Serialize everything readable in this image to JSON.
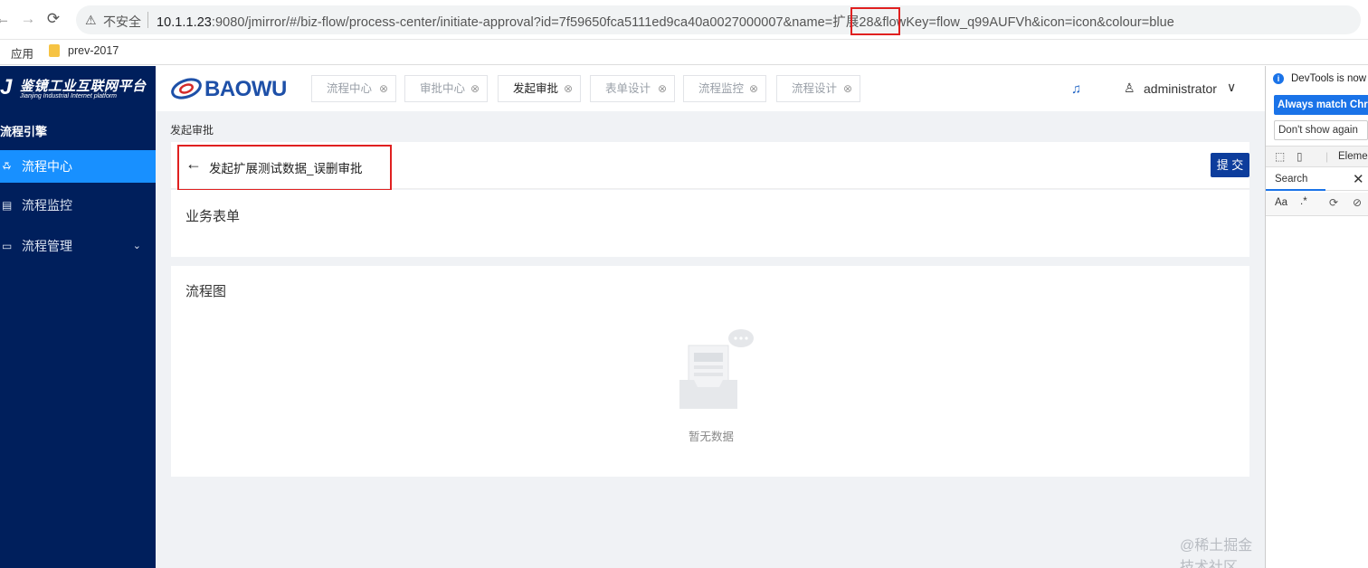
{
  "browser": {
    "security_label": "不安全",
    "url_host": "10.1.1.23",
    "url_rest": ":9080/jmirror/#/biz-flow/process-center/initiate-approval?id=7f59650fca5111ed9ca40a0027000007&name=扩展28&flowKey=flow_q99AUFVh&icon=icon&colour=blue",
    "bookmarks": [
      "应用",
      "prev-2017"
    ]
  },
  "sidebar": {
    "logo_cn": "鉴镜工业互联网平台",
    "logo_en": "Jianjing Industrial Internet platform",
    "section_title": "流程引擎",
    "items": [
      {
        "label": "流程中心",
        "icon": "user-group-icon",
        "active": true
      },
      {
        "label": "流程监控",
        "icon": "monitor-doc-icon",
        "active": false
      },
      {
        "label": "流程管理",
        "icon": "folder-icon",
        "active": false
      }
    ]
  },
  "header": {
    "brand": "BAOWU",
    "tabs": [
      {
        "label": "流程中心",
        "active": false
      },
      {
        "label": "审批中心",
        "active": false
      },
      {
        "label": "发起审批",
        "active": true
      },
      {
        "label": "表单设计",
        "active": false
      },
      {
        "label": "流程监控",
        "active": false
      },
      {
        "label": "流程设计",
        "active": false
      }
    ],
    "username": "administrator"
  },
  "main": {
    "breadcrumb": "发起审批",
    "page_title": "发起扩展测试数据_误删审批",
    "submit_label": "提 交",
    "form_section_title": "业务表单",
    "flow_section_title": "流程图",
    "empty_text": "暂无数据",
    "watermark": "@稀土掘金技术社区"
  },
  "devtools": {
    "info_text": "DevTools is now",
    "match_button": "Always match Chro",
    "dismiss_button": "Don't show again",
    "elements_tab": "Eleme",
    "search_tab": "Search",
    "case_toggle": "Aa",
    "regex_toggle": ".*"
  },
  "colors": {
    "sidebar_bg": "#001f5c",
    "active_item": "#1890ff",
    "submit_bg": "#0d3d9c",
    "highlight_border": "#e02020"
  }
}
